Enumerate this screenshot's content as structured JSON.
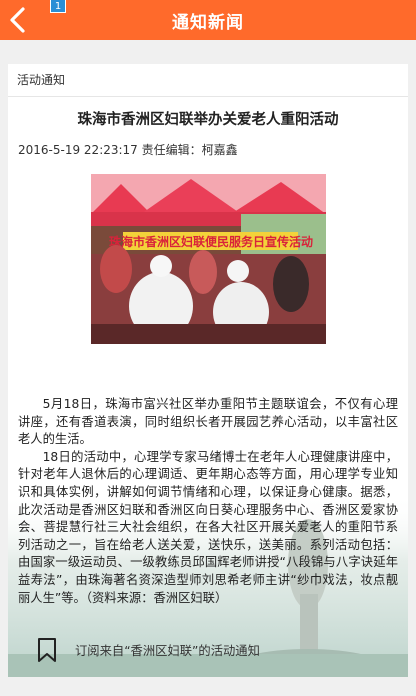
{
  "header": {
    "title": "通知新闻",
    "badge": "1"
  },
  "article": {
    "category": "活动通知",
    "title": "珠海市香洲区妇联举办关爱老人重阳活动",
    "meta": "2016-5-19 22:23:17 责任编辑：柯嘉鑫",
    "banner_text": "珠海市香洲区妇联便民服务日宣传活动",
    "paragraphs": [
      "5月18日，珠海市富兴社区举办重阳节主题联谊会，不仅有心理讲座，还有香道表演，同时组织长者开展园艺养心活动，以丰富社区老人的生活。",
      "18日的活动中，心理学专家马绪博士在老年人心理健康讲座中，针对老年人退休后的心理调适、更年期心态等方面，用心理学专业知识和具体实例，讲解如何调节情绪和心理，以保证身心健康。据悉，此次活动是香洲区妇联和香洲区向日葵心理服务中心、香洲区爱家协会、菩提慧行社三大社会组织，在各大社区开展关爱老人的重阳节系列活动之一，旨在给老人送关爱，送快乐，送美丽。系列活动包括：由国家一级运动员、一级教练员邱国辉老师讲授“八段锦与八字诀延年益寿法”，由珠海著名资深造型师刘思希老师主讲“纱巾戏法，妆点靓丽人生”等。（资料来源：香洲区妇联）"
    ],
    "subscribe_text": "订阅来自“香洲区妇联”的活动通知"
  },
  "colors": {
    "header_bg": "#ff6a2b",
    "badge_bg": "#2a8fd6"
  }
}
